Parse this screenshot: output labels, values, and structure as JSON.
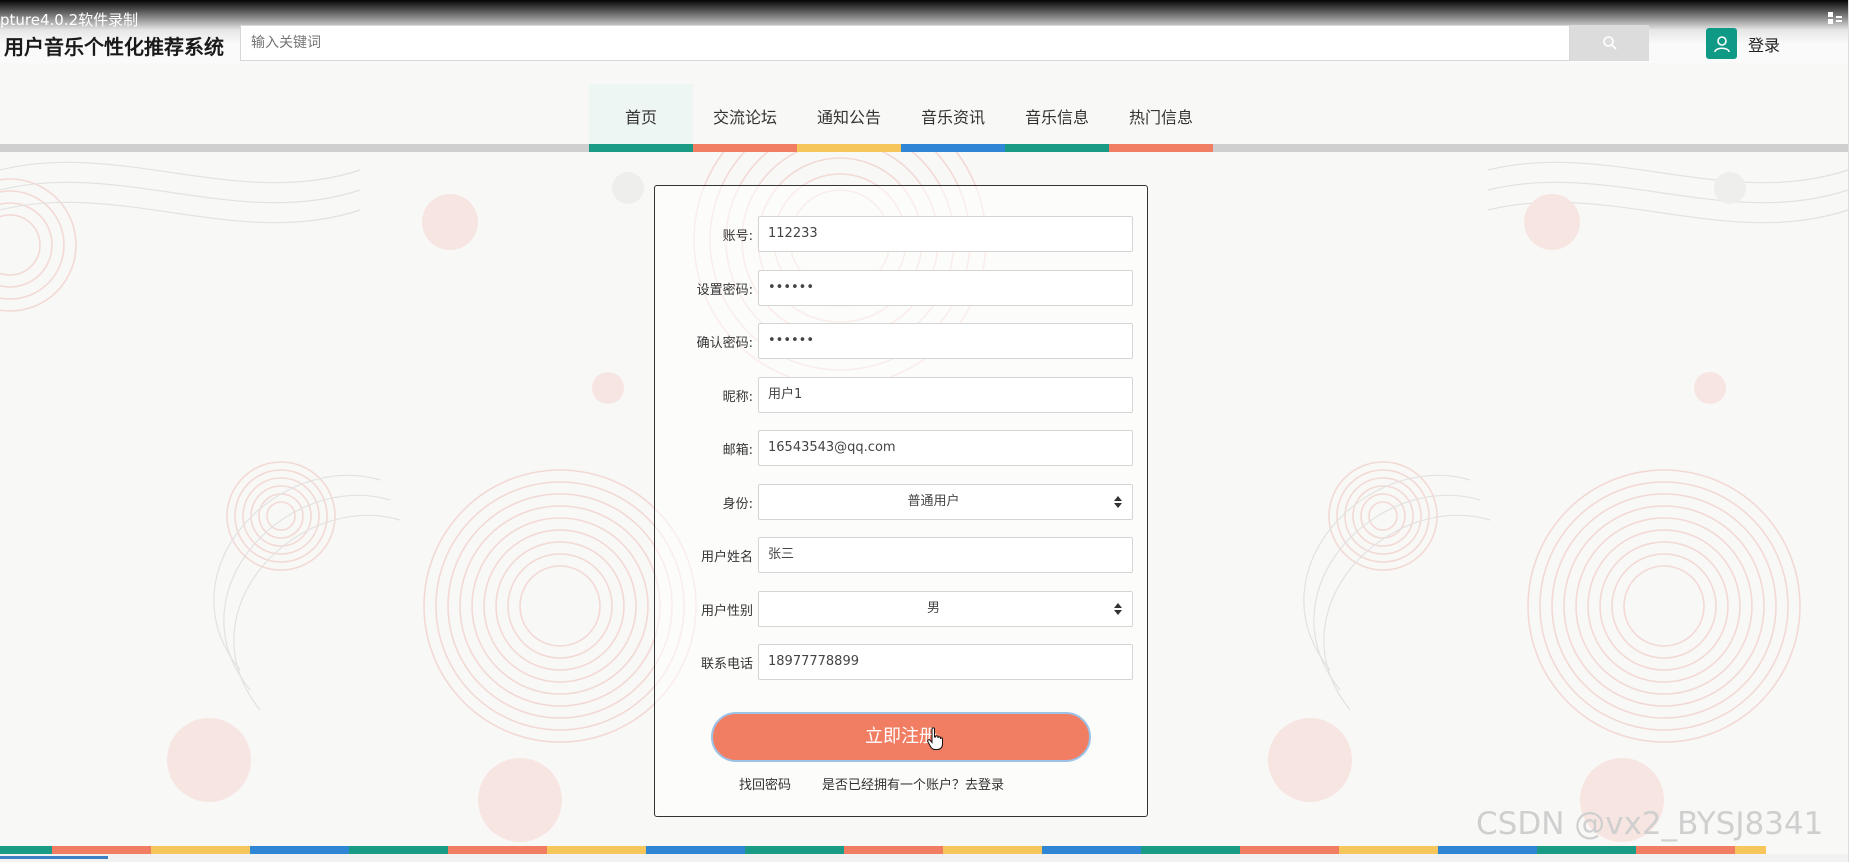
{
  "recorder_label": "pture4.0.2软件录制",
  "site_title": "用户音乐个性化推荐系统",
  "search": {
    "placeholder": "输入关键词"
  },
  "login_label": "登录",
  "nav": {
    "items": [
      {
        "label": "首页",
        "active": true,
        "color": "#1a9b86"
      },
      {
        "label": "交流论坛",
        "active": false,
        "color": "#f17e63"
      },
      {
        "label": "通知公告",
        "active": false,
        "color": "#f7c65b"
      },
      {
        "label": "音乐资讯",
        "active": false,
        "color": "#2f86d4"
      },
      {
        "label": "音乐信息",
        "active": false,
        "color": "#1a9b86"
      },
      {
        "label": "热门信息",
        "active": false,
        "color": "#f17e63"
      }
    ]
  },
  "form": {
    "account": {
      "label": "账号:",
      "value": "112233"
    },
    "password": {
      "label": "设置密码:",
      "value": "••••••"
    },
    "confirm_password": {
      "label": "确认密码:",
      "value": "••••••"
    },
    "nickname": {
      "label": "昵称:",
      "value": "用户1"
    },
    "email": {
      "label": "邮箱:",
      "value": "16543543@qq.com"
    },
    "role": {
      "label": "身份:",
      "value": "普通用户"
    },
    "real_name": {
      "label": "用户姓名",
      "value": "张三"
    },
    "gender": {
      "label": "用户性别",
      "value": "男"
    },
    "phone": {
      "label": "联系电话",
      "value": "18977778899"
    },
    "submit_label": "立即注册",
    "forgot_password": "找回密码",
    "have_account": "是否已经拥有一个账户？去登录"
  },
  "watermark": "CSDN @vx2_BYSJ8341",
  "colors": {
    "teal": "#1a9b86",
    "coral": "#f17e63",
    "yellow": "#f7c65b",
    "blue": "#2f86d4"
  }
}
